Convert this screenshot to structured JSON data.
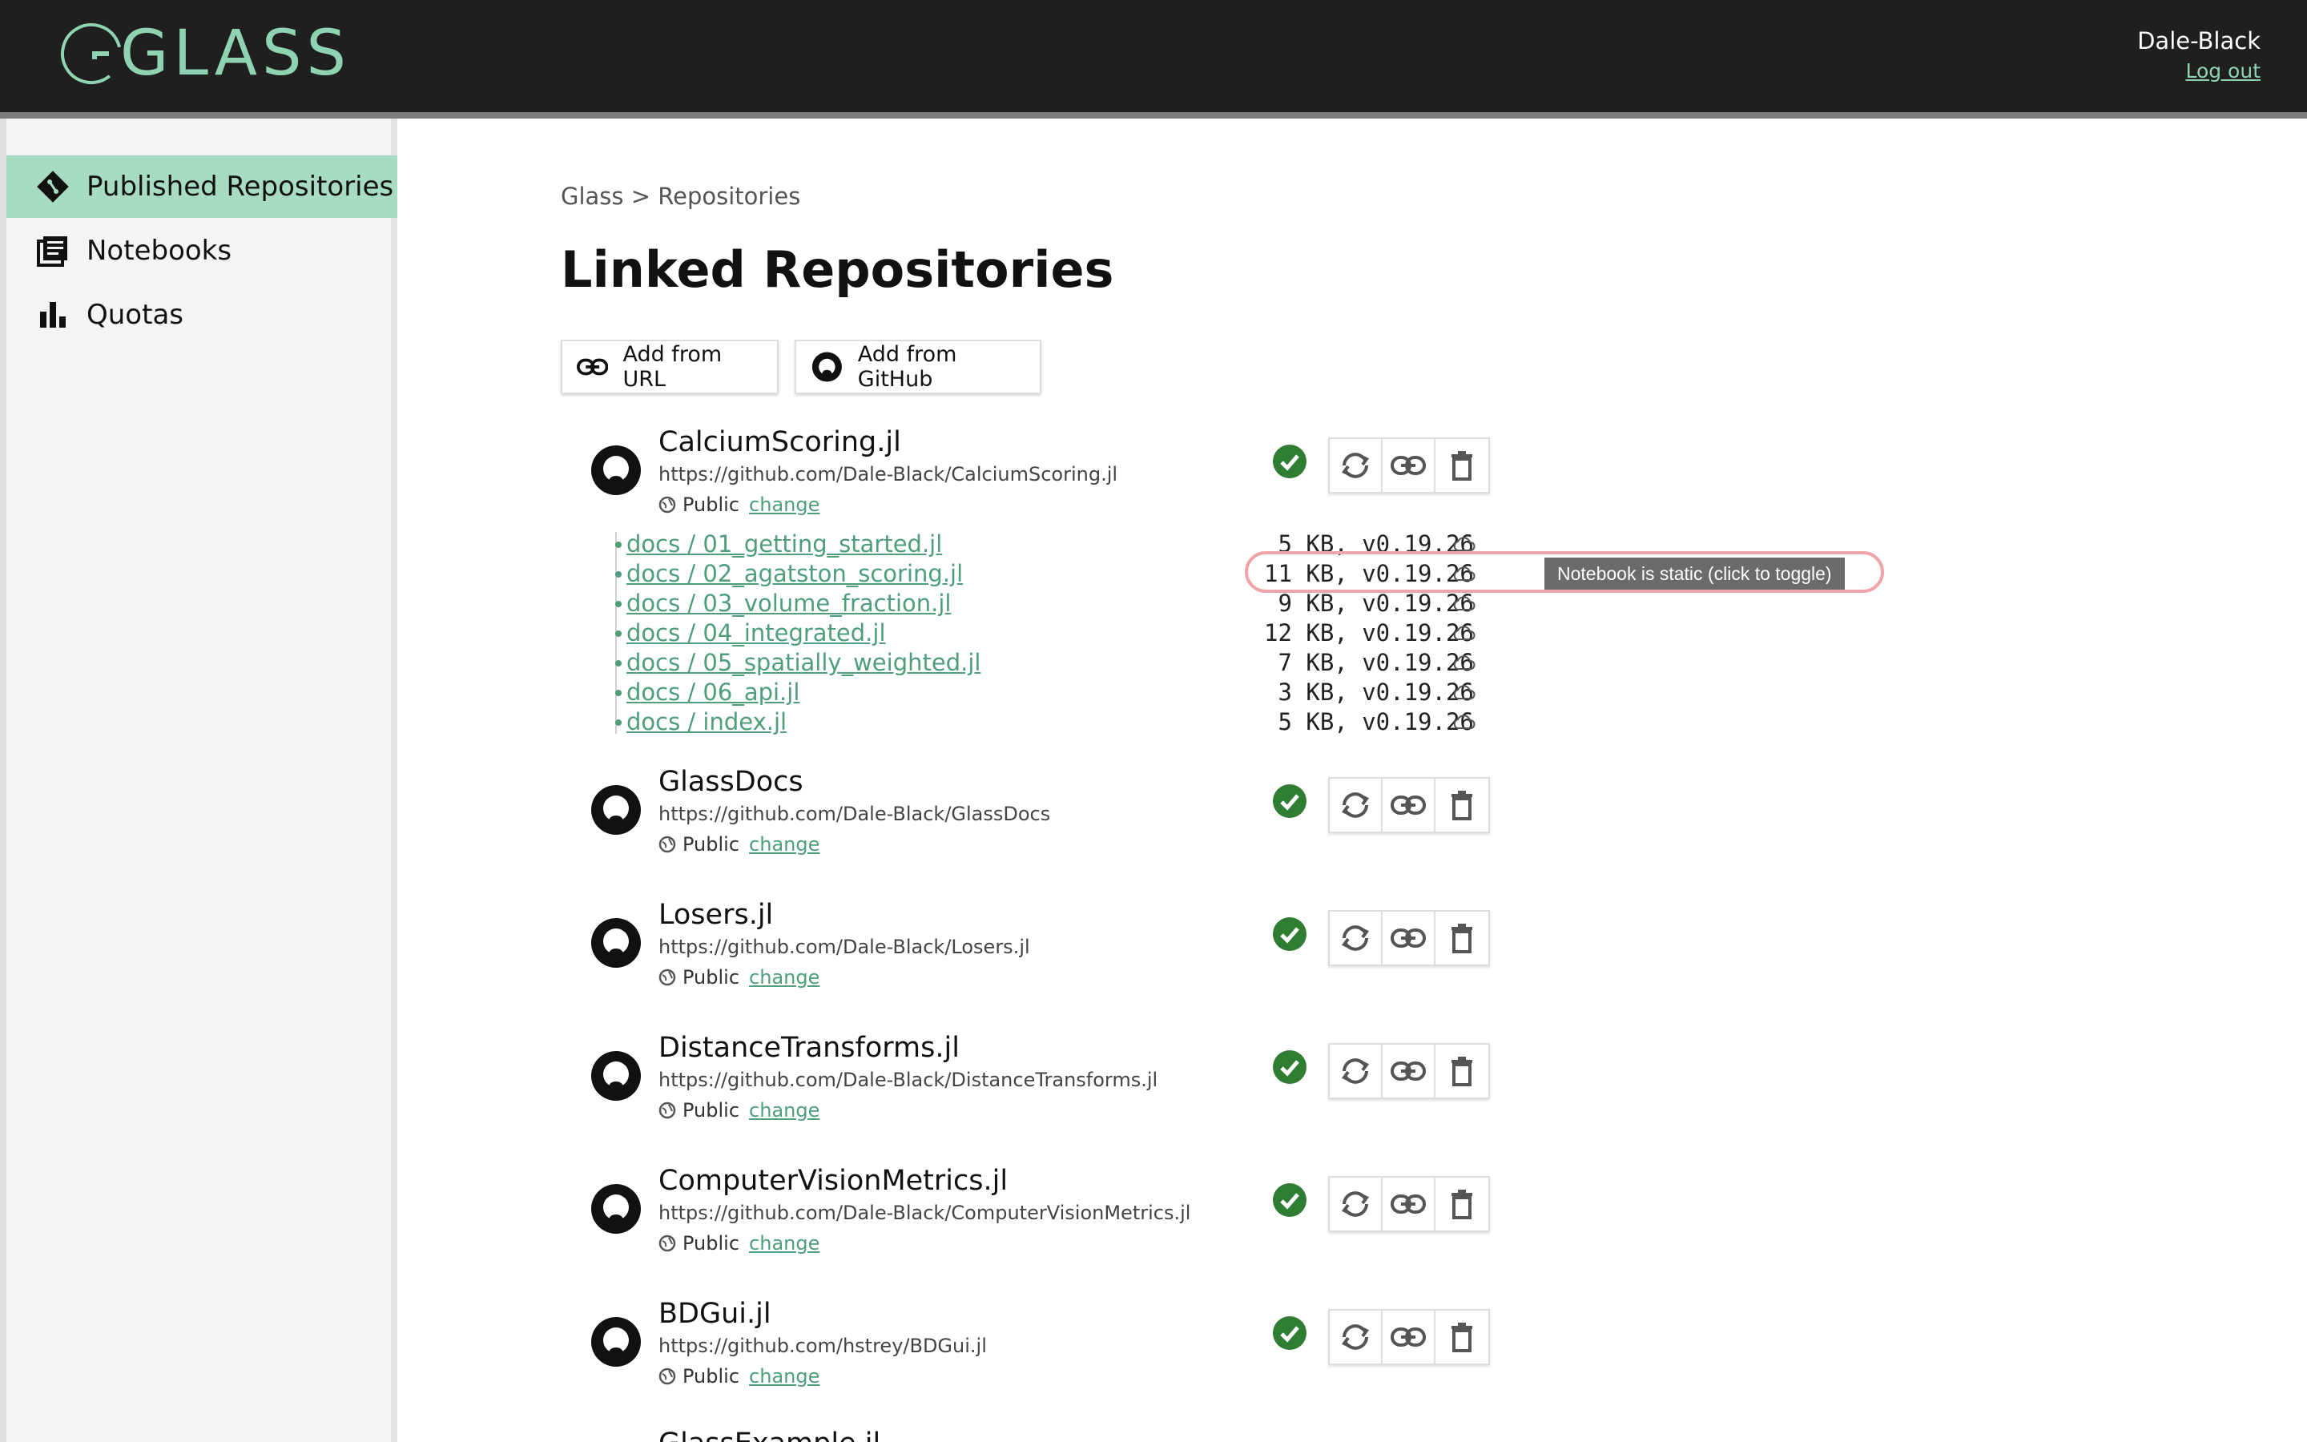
{
  "header": {
    "logo_text": "GLASS",
    "user_name": "Dale-Black",
    "logout_label": "Log out",
    "accent_color": "#8fd3b3"
  },
  "sidebar": {
    "items": [
      {
        "label": "Published Repositories",
        "icon": "git-diamond-icon",
        "active": true
      },
      {
        "label": "Notebooks",
        "icon": "notebooks-icon",
        "active": false
      },
      {
        "label": "Quotas",
        "icon": "bar-chart-icon",
        "active": false
      }
    ]
  },
  "main": {
    "breadcrumb": "Glass > Repositories",
    "title": "Linked Repositories",
    "add_url_label": "Add from URL",
    "add_github_label": "Add from GitHub",
    "visibility_label": "Public",
    "change_label": "change",
    "tooltip": "Notebook is static (click to toggle)",
    "repos": [
      {
        "name": "CalciumScoring.jl",
        "url": "https://github.com/Dale-Black/CalciumScoring.jl"
      },
      {
        "name": "GlassDocs",
        "url": "https://github.com/Dale-Black/GlassDocs"
      },
      {
        "name": "Losers.jl",
        "url": "https://github.com/Dale-Black/Losers.jl"
      },
      {
        "name": "DistanceTransforms.jl",
        "url": "https://github.com/Dale-Black/DistanceTransforms.jl"
      },
      {
        "name": "ComputerVisionMetrics.jl",
        "url": "https://github.com/Dale-Black/ComputerVisionMetrics.jl"
      },
      {
        "name": "BDGui.jl",
        "url": "https://github.com/hstrey/BDGui.jl"
      },
      {
        "name": "GlassExample.jl",
        "url": ""
      }
    ],
    "notebooks": [
      {
        "path": "docs / 01_getting_started.jl",
        "meta": " 5 KB, v0.19.26"
      },
      {
        "path": "docs / 02_agatston_scoring.jl",
        "meta": "11 KB, v0.19.26"
      },
      {
        "path": "docs / 03_volume_fraction.jl",
        "meta": " 9 KB, v0.19.26"
      },
      {
        "path": "docs / 04_integrated.jl",
        "meta": "12 KB, v0.19.26"
      },
      {
        "path": "docs / 05_spatially_weighted.jl",
        "meta": " 7 KB, v0.19.26"
      },
      {
        "path": "docs / 06_api.jl",
        "meta": " 3 KB, v0.19.26"
      },
      {
        "path": "docs / index.jl",
        "meta": " 5 KB, v0.19.26"
      }
    ]
  }
}
